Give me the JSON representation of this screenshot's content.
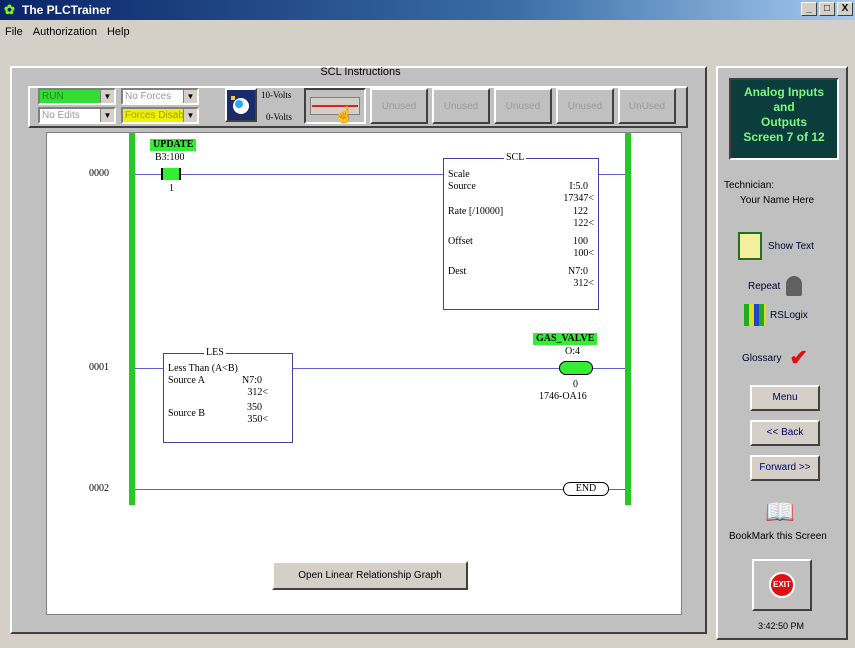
{
  "window": {
    "title": "The PLCTrainer",
    "controls": [
      "_",
      "□",
      "X"
    ]
  },
  "menu": [
    "File",
    "Authorization",
    "Help"
  ],
  "main": {
    "title": "SCL Instructions",
    "toolbar": {
      "mode_select": "RUN",
      "forces_select": "No Forces",
      "edits_select": "No Edits",
      "forces_disabled_select": "Forces Disabl",
      "volts_top": "10-Volts",
      "volts_bottom": "0-Volts",
      "unused_buttons": [
        "Unused",
        "Unused",
        "Unused",
        "Unused",
        "UnUsed"
      ]
    },
    "rungs": [
      {
        "number": "0000",
        "contact_tag": "UPDATE",
        "contact_address": "B3:100",
        "contact_bit": "1",
        "instruction": {
          "name": "SCL",
          "title": "Scale",
          "rows": [
            {
              "label": "Source",
              "value": "I:5.0",
              "live": "17347<"
            },
            {
              "label": "Rate [/10000]",
              "value": "122",
              "live": "122<"
            },
            {
              "label": "Offset",
              "value": "100",
              "live": "100<"
            },
            {
              "label": "Dest",
              "value": "N7:0",
              "live": "312<"
            }
          ]
        }
      },
      {
        "number": "0001",
        "instruction": {
          "name": "LES",
          "title": "Less Than (A<B)",
          "rows": [
            {
              "label": "Source A",
              "value": "N7:0",
              "live": "312<"
            },
            {
              "label": "Source B",
              "value": "350",
              "live": "350<"
            }
          ]
        },
        "coil_tag": "GAS_VALVE",
        "coil_address": "O:4",
        "coil_bit": "0",
        "coil_module": "1746-OA16"
      },
      {
        "number": "0002",
        "end_label": "END"
      }
    ],
    "open_graph_button": "Open Linear Relationship Graph"
  },
  "sidebar": {
    "banner": [
      "Analog Inputs",
      "and",
      "Outputs",
      "Screen 7 of 12"
    ],
    "technician_label": "Technician:",
    "technician_name": "Your Name Here",
    "show_text": "Show Text",
    "repeat": "Repeat",
    "rslogix": "RSLogix",
    "glossary": "Glossary",
    "menu_button": "Menu",
    "back_button": "<< Back",
    "forward_button": "Forward >>",
    "bookmark": "BookMark this Screen",
    "exit_label": "EXIT",
    "time": "3:42:50 PM"
  },
  "colors": {
    "rail_green": "#22cc22",
    "tag_green": "#33ee33",
    "run_green": "#33dd33",
    "forces_yellow": "#f0f000",
    "banner_bg": "#0b3d3d",
    "banner_text": "#7ff77f"
  }
}
